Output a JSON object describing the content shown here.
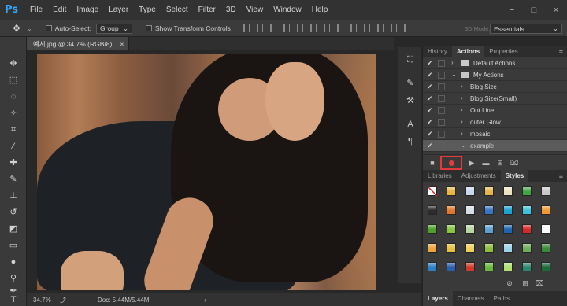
{
  "app": {
    "logo": "Ps"
  },
  "menu": [
    "File",
    "Edit",
    "Image",
    "Layer",
    "Type",
    "Select",
    "Filter",
    "3D",
    "View",
    "Window",
    "Help"
  ],
  "window_controls": [
    "−",
    "□",
    "×"
  ],
  "options": {
    "auto_select_label": "Auto-Select:",
    "auto_select_value": "Group",
    "show_transform_label": "Show Transform Controls",
    "mode_3d": "3D Mode:",
    "workspace": "Essentials"
  },
  "document": {
    "tab_title": "예시.jpg @ 34.7% (RGB/8)",
    "close": "×"
  },
  "status": {
    "zoom": "34.7%",
    "doc_size": "Doc: 5.44M/5.44M",
    "arrow": "›"
  },
  "actions_panel": {
    "tabs": [
      "History",
      "Actions",
      "Properties"
    ],
    "active_tab": "Actions",
    "rows": [
      {
        "check": "✔",
        "label": "Default Actions",
        "folder": true,
        "indent": 0
      },
      {
        "check": "✔",
        "label": "My Actions",
        "folder": true,
        "indent": 0
      },
      {
        "check": "✔",
        "label": "Blog Size",
        "folder": false,
        "indent": 1
      },
      {
        "check": "✔",
        "label": "Blog Size(Small)",
        "folder": false,
        "indent": 1
      },
      {
        "check": "✔",
        "label": "Out Line",
        "folder": false,
        "indent": 1
      },
      {
        "check": "✔",
        "label": "outer Glow",
        "folder": false,
        "indent": 1
      },
      {
        "check": "✔",
        "label": "mosaic",
        "folder": false,
        "indent": 1
      },
      {
        "check": "✔",
        "label": "example",
        "folder": false,
        "indent": 1,
        "selected": true
      }
    ]
  },
  "styles_panel": {
    "tabs": [
      "Libraries",
      "Adjustments",
      "Styles"
    ],
    "active_tab": "Styles",
    "swatch_colors": [
      [
        "#ffffff",
        "#e8b73a",
        "#c6d7ee",
        "#e6b54a",
        "#ede3c0",
        "#3fa640",
        "#c7c7c7"
      ],
      [
        "#2b2b2b",
        "#e27826",
        "#d8dee8",
        "#3975c5",
        "#1da1cf",
        "#3cc3d9",
        "#ef9a36"
      ],
      [
        "#4da129",
        "#87c63f",
        "#b9d5a1",
        "#5fa0d2",
        "#1e64b0",
        "#d8282a",
        "#fafafa"
      ],
      [
        "#eca63a",
        "#e6c23c",
        "#f0d05c",
        "#8dbd3a",
        "#9fd1e8",
        "#6eae5a",
        "#3a8b3a"
      ],
      [
        "#2f7fc7",
        "#2a5fb0",
        "#d03a2a",
        "#67b83a",
        "#b0e070",
        "#2a8a70",
        "#1e6a3a"
      ]
    ]
  },
  "layers_panel": {
    "tabs": [
      "Layers",
      "Channels",
      "Paths"
    ],
    "active_tab": "Layers"
  }
}
